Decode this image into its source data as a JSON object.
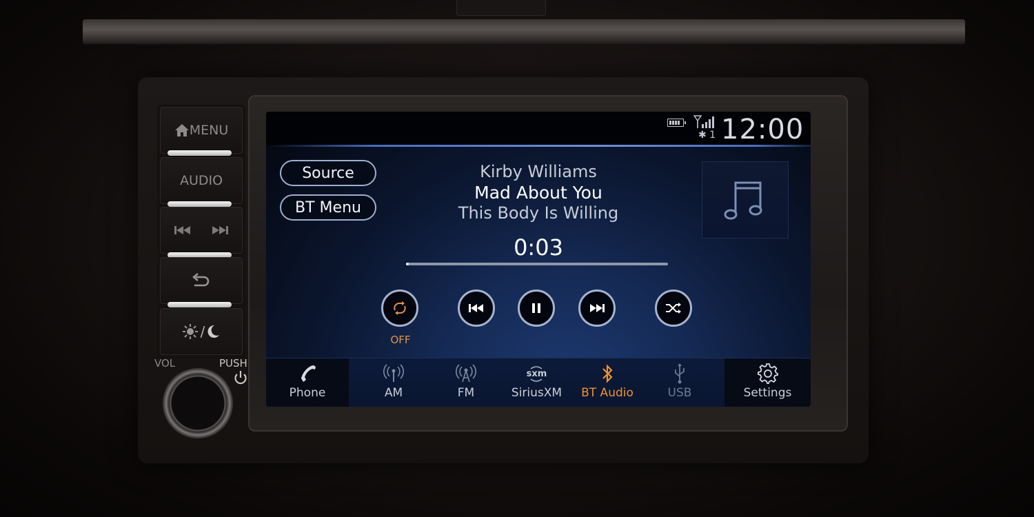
{
  "status": {
    "clock": "12:00",
    "bt_device_number": "1",
    "battery_icon": "battery-icon",
    "signal_icon": "signal-icon",
    "bluetooth_icon": "bluetooth-icon"
  },
  "buttons": {
    "source_label": "Source",
    "bt_menu_label": "BT Menu"
  },
  "track": {
    "artist": "Kirby Williams",
    "title": "Mad About You",
    "album": "This Body Is Willing",
    "elapsed": "0:03",
    "progress_fraction": 0.01,
    "album_art_icon": "music-note-icon"
  },
  "controls": {
    "repeat_state": "OFF",
    "repeat_icon": "repeat-icon",
    "previous_icon": "previous-track-icon",
    "pause_icon": "pause-icon",
    "next_icon": "next-track-icon",
    "shuffle_icon": "shuffle-icon",
    "accent_color": "#e2914a"
  },
  "nav": {
    "items": [
      {
        "label": "Phone",
        "icon": "phone-icon",
        "state": "normal"
      },
      {
        "label": "AM",
        "icon": "am-radio-icon",
        "state": "normal"
      },
      {
        "label": "FM",
        "icon": "fm-radio-icon",
        "state": "normal"
      },
      {
        "label": "SiriusXM",
        "icon": "siriusxm-icon",
        "state": "normal"
      },
      {
        "label": "BT Audio",
        "icon": "bluetooth-icon",
        "state": "active"
      },
      {
        "label": "USB",
        "icon": "usb-icon",
        "state": "disabled"
      },
      {
        "label": "Settings",
        "icon": "gear-icon",
        "state": "normal"
      }
    ],
    "active_color": "#f0922f",
    "sxm_text": "sxm"
  },
  "hardware": {
    "menu_label": "MENU",
    "audio_label": "AUDIO",
    "vol_label": "VOL",
    "push_label": "PUSH",
    "day_night_sep": "/"
  }
}
